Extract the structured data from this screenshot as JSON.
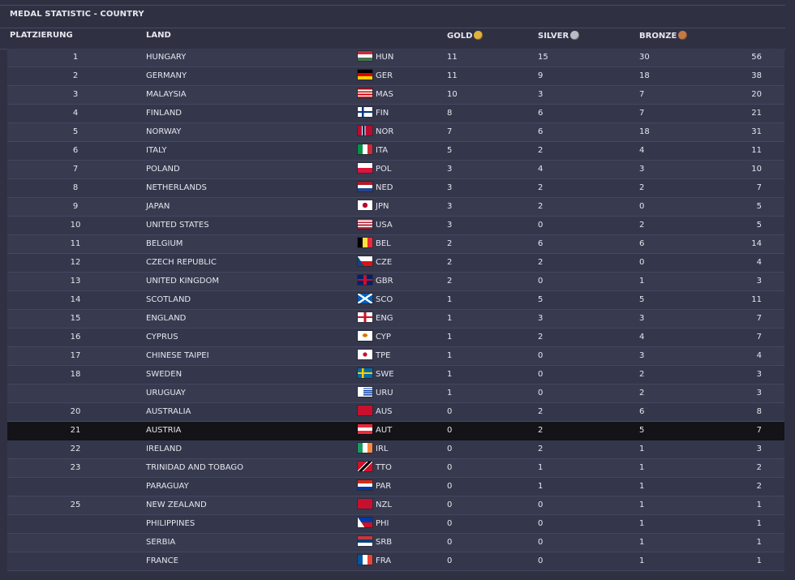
{
  "title": "MEDAL STATISTIC - COUNTRY",
  "headers": {
    "rank": "PLATZIERUNG",
    "land": "LAND",
    "gold": "GOLD",
    "silver": "SILVER",
    "bronze": "BRONZE"
  },
  "colors": {
    "gold": "#e2b13c",
    "silver": "#b9bcc4",
    "bronze": "#c47a45",
    "highlight": "#131318"
  },
  "highlight_country": "AUSTRIA",
  "rows": [
    {
      "rank": "1",
      "land": "HUNGARY",
      "code": "HUN",
      "gold": "11",
      "silver": "15",
      "bronze": "30",
      "total": "56"
    },
    {
      "rank": "2",
      "land": "GERMANY",
      "code": "GER",
      "gold": "11",
      "silver": "9",
      "bronze": "18",
      "total": "38"
    },
    {
      "rank": "3",
      "land": "MALAYSIA",
      "code": "MAS",
      "gold": "10",
      "silver": "3",
      "bronze": "7",
      "total": "20"
    },
    {
      "rank": "4",
      "land": "FINLAND",
      "code": "FIN",
      "gold": "8",
      "silver": "6",
      "bronze": "7",
      "total": "21"
    },
    {
      "rank": "5",
      "land": "NORWAY",
      "code": "NOR",
      "gold": "7",
      "silver": "6",
      "bronze": "18",
      "total": "31"
    },
    {
      "rank": "6",
      "land": "ITALY",
      "code": "ITA",
      "gold": "5",
      "silver": "2",
      "bronze": "4",
      "total": "11"
    },
    {
      "rank": "7",
      "land": "POLAND",
      "code": "POL",
      "gold": "3",
      "silver": "4",
      "bronze": "3",
      "total": "10"
    },
    {
      "rank": "8",
      "land": "NETHERLANDS",
      "code": "NED",
      "gold": "3",
      "silver": "2",
      "bronze": "2",
      "total": "7"
    },
    {
      "rank": "9",
      "land": "JAPAN",
      "code": "JPN",
      "gold": "3",
      "silver": "2",
      "bronze": "0",
      "total": "5"
    },
    {
      "rank": "10",
      "land": "UNITED STATES",
      "code": "USA",
      "gold": "3",
      "silver": "0",
      "bronze": "2",
      "total": "5"
    },
    {
      "rank": "11",
      "land": "BELGIUM",
      "code": "BEL",
      "gold": "2",
      "silver": "6",
      "bronze": "6",
      "total": "14"
    },
    {
      "rank": "12",
      "land": "CZECH REPUBLIC",
      "code": "CZE",
      "gold": "2",
      "silver": "2",
      "bronze": "0",
      "total": "4"
    },
    {
      "rank": "13",
      "land": "UNITED KINGDOM",
      "code": "GBR",
      "gold": "2",
      "silver": "0",
      "bronze": "1",
      "total": "3"
    },
    {
      "rank": "14",
      "land": "SCOTLAND",
      "code": "SCO",
      "gold": "1",
      "silver": "5",
      "bronze": "5",
      "total": "11"
    },
    {
      "rank": "15",
      "land": "ENGLAND",
      "code": "ENG",
      "gold": "1",
      "silver": "3",
      "bronze": "3",
      "total": "7"
    },
    {
      "rank": "16",
      "land": "CYPRUS",
      "code": "CYP",
      "gold": "1",
      "silver": "2",
      "bronze": "4",
      "total": "7"
    },
    {
      "rank": "17",
      "land": "CHINESE TAIPEI",
      "code": "TPE",
      "gold": "1",
      "silver": "0",
      "bronze": "3",
      "total": "4"
    },
    {
      "rank": "18",
      "land": "SWEDEN",
      "code": "SWE",
      "gold": "1",
      "silver": "0",
      "bronze": "2",
      "total": "3"
    },
    {
      "rank": "",
      "land": "URUGUAY",
      "code": "URU",
      "gold": "1",
      "silver": "0",
      "bronze": "2",
      "total": "3"
    },
    {
      "rank": "20",
      "land": "AUSTRALIA",
      "code": "AUS",
      "gold": "0",
      "silver": "2",
      "bronze": "6",
      "total": "8"
    },
    {
      "rank": "21",
      "land": "AUSTRIA",
      "code": "AUT",
      "gold": "0",
      "silver": "2",
      "bronze": "5",
      "total": "7"
    },
    {
      "rank": "22",
      "land": "IRELAND",
      "code": "IRL",
      "gold": "0",
      "silver": "2",
      "bronze": "1",
      "total": "3"
    },
    {
      "rank": "23",
      "land": "TRINIDAD AND TOBAGO",
      "code": "TTO",
      "gold": "0",
      "silver": "1",
      "bronze": "1",
      "total": "2"
    },
    {
      "rank": "",
      "land": "PARAGUAY",
      "code": "PAR",
      "gold": "0",
      "silver": "1",
      "bronze": "1",
      "total": "2"
    },
    {
      "rank": "25",
      "land": "NEW ZEALAND",
      "code": "NZL",
      "gold": "0",
      "silver": "0",
      "bronze": "1",
      "total": "1"
    },
    {
      "rank": "",
      "land": "PHILIPPINES",
      "code": "PHI",
      "gold": "0",
      "silver": "0",
      "bronze": "1",
      "total": "1"
    },
    {
      "rank": "",
      "land": "SERBIA",
      "code": "SRB",
      "gold": "0",
      "silver": "0",
      "bronze": "1",
      "total": "1"
    },
    {
      "rank": "",
      "land": "FRANCE",
      "code": "FRA",
      "gold": "0",
      "silver": "0",
      "bronze": "1",
      "total": "1"
    }
  ]
}
